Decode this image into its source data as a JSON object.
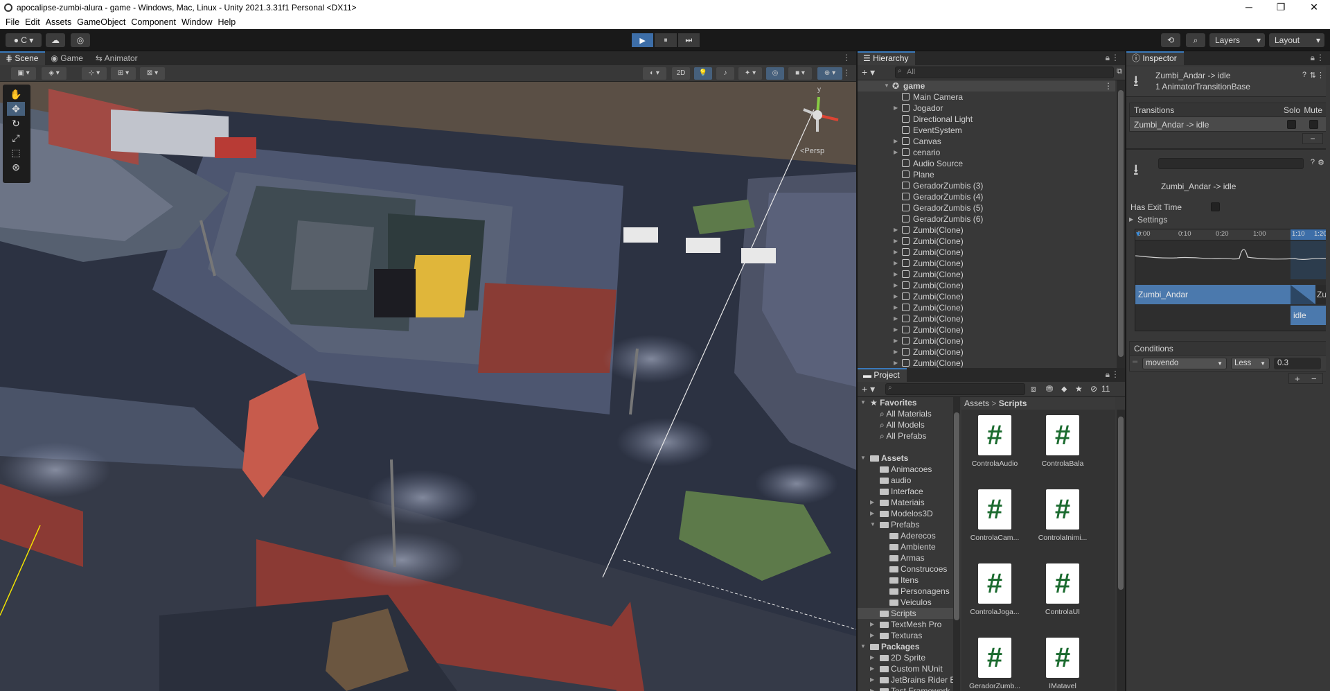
{
  "window": {
    "title": "apocalipse-zumbi-alura - game - Windows, Mac, Linux - Unity 2021.3.31f1 Personal <DX11>",
    "controls": [
      "─",
      "❐",
      "✕"
    ]
  },
  "menu": [
    "File",
    "Edit",
    "Assets",
    "GameObject",
    "Component",
    "Window",
    "Help"
  ],
  "toolbar": {
    "account_label": "C",
    "play": "▶",
    "pause": "⏸",
    "step": "⏭",
    "layers_label": "Layers",
    "layout_label": "Layout"
  },
  "scene_panel": {
    "tabs": [
      "Scene",
      "Game",
      "Animator"
    ],
    "mode_2d": "2D",
    "persp_label": "<Persp",
    "axis_y": "y"
  },
  "hierarchy": {
    "tab": "Hierarchy",
    "search_placeholder": "All",
    "root": "game",
    "items": [
      {
        "label": "Main Camera",
        "expandable": false
      },
      {
        "label": "Jogador",
        "expandable": true
      },
      {
        "label": "Directional Light",
        "expandable": false
      },
      {
        "label": "EventSystem",
        "expandable": false
      },
      {
        "label": "Canvas",
        "expandable": true
      },
      {
        "label": "cenario",
        "expandable": true
      },
      {
        "label": "Audio Source",
        "expandable": false
      },
      {
        "label": "Plane",
        "expandable": false
      },
      {
        "label": "GeradorZumbis (3)",
        "expandable": false
      },
      {
        "label": "GeradorZumbis (4)",
        "expandable": false
      },
      {
        "label": "GeradorZumbis (5)",
        "expandable": false
      },
      {
        "label": "GeradorZumbis (6)",
        "expandable": false
      },
      {
        "label": "Zumbi(Clone)",
        "expandable": true
      },
      {
        "label": "Zumbi(Clone)",
        "expandable": true
      },
      {
        "label": "Zumbi(Clone)",
        "expandable": true
      },
      {
        "label": "Zumbi(Clone)",
        "expandable": true
      },
      {
        "label": "Zumbi(Clone)",
        "expandable": true
      },
      {
        "label": "Zumbi(Clone)",
        "expandable": true
      },
      {
        "label": "Zumbi(Clone)",
        "expandable": true
      },
      {
        "label": "Zumbi(Clone)",
        "expandable": true
      },
      {
        "label": "Zumbi(Clone)",
        "expandable": true
      },
      {
        "label": "Zumbi(Clone)",
        "expandable": true
      },
      {
        "label": "Zumbi(Clone)",
        "expandable": true
      },
      {
        "label": "Zumbi(Clone)",
        "expandable": true
      },
      {
        "label": "Zumbi(Clone)",
        "expandable": true
      }
    ]
  },
  "project": {
    "tab": "Project",
    "hidden_count": "11",
    "breadcrumb": [
      "Assets",
      "Scripts"
    ],
    "tree": [
      {
        "label": "Favorites",
        "depth": 0,
        "kind": "star",
        "arrow": "▼",
        "bold": true
      },
      {
        "label": "All Materials",
        "depth": 1,
        "kind": "search",
        "arrow": "",
        "bold": false
      },
      {
        "label": "All Models",
        "depth": 1,
        "kind": "search",
        "arrow": "",
        "bold": false
      },
      {
        "label": "All Prefabs",
        "depth": 1,
        "kind": "search",
        "arrow": "",
        "bold": false
      },
      {
        "label": "",
        "depth": 0,
        "kind": "none",
        "arrow": "",
        "bold": false
      },
      {
        "label": "Assets",
        "depth": 0,
        "kind": "folder",
        "arrow": "▼",
        "bold": true
      },
      {
        "label": "Animacoes",
        "depth": 1,
        "kind": "folder",
        "arrow": "",
        "bold": false
      },
      {
        "label": "audio",
        "depth": 1,
        "kind": "folder",
        "arrow": "",
        "bold": false
      },
      {
        "label": "Interface",
        "depth": 1,
        "kind": "folder",
        "arrow": "",
        "bold": false
      },
      {
        "label": "Materiais",
        "depth": 1,
        "kind": "folder",
        "arrow": "▶",
        "bold": false
      },
      {
        "label": "Modelos3D",
        "depth": 1,
        "kind": "folder",
        "arrow": "▶",
        "bold": false
      },
      {
        "label": "Prefabs",
        "depth": 1,
        "kind": "folder",
        "arrow": "▼",
        "bold": false
      },
      {
        "label": "Aderecos",
        "depth": 2,
        "kind": "folder",
        "arrow": "",
        "bold": false
      },
      {
        "label": "Ambiente",
        "depth": 2,
        "kind": "folder",
        "arrow": "",
        "bold": false
      },
      {
        "label": "Armas",
        "depth": 2,
        "kind": "folder",
        "arrow": "",
        "bold": false
      },
      {
        "label": "Construcoes",
        "depth": 2,
        "kind": "folder",
        "arrow": "",
        "bold": false
      },
      {
        "label": "Itens",
        "depth": 2,
        "kind": "folder",
        "arrow": "",
        "bold": false
      },
      {
        "label": "Personagens",
        "depth": 2,
        "kind": "folder",
        "arrow": "",
        "bold": false
      },
      {
        "label": "Veiculos",
        "depth": 2,
        "kind": "folder",
        "arrow": "",
        "bold": false
      },
      {
        "label": "Scripts",
        "depth": 1,
        "kind": "folder",
        "arrow": "",
        "bold": false
      },
      {
        "label": "TextMesh Pro",
        "depth": 1,
        "kind": "folder",
        "arrow": "▶",
        "bold": false
      },
      {
        "label": "Texturas",
        "depth": 1,
        "kind": "folder",
        "arrow": "▶",
        "bold": false
      },
      {
        "label": "Packages",
        "depth": 0,
        "kind": "folder",
        "arrow": "▼",
        "bold": true
      },
      {
        "label": "2D Sprite",
        "depth": 1,
        "kind": "folder",
        "arrow": "▶",
        "bold": false
      },
      {
        "label": "Custom NUnit",
        "depth": 1,
        "kind": "folder",
        "arrow": "▶",
        "bold": false
      },
      {
        "label": "JetBrains Rider E",
        "depth": 1,
        "kind": "folder",
        "arrow": "▶",
        "bold": false
      },
      {
        "label": "Test Framework",
        "depth": 1,
        "kind": "folder",
        "arrow": "▶",
        "bold": false
      }
    ],
    "selected_folder": "Scripts",
    "assets": [
      {
        "label": "ControlaAudio",
        "glyph": "#"
      },
      {
        "label": "ControlaBala",
        "glyph": "#"
      },
      {
        "label": "ControlaCam...",
        "glyph": "#"
      },
      {
        "label": "ControlaInimi...",
        "glyph": "#"
      },
      {
        "label": "ControlaJoga...",
        "glyph": "#"
      },
      {
        "label": "ControlaUI",
        "glyph": "#"
      },
      {
        "label": "GeradorZumb...",
        "glyph": "#"
      },
      {
        "label": "IMatavel",
        "glyph": "#"
      }
    ]
  },
  "inspector": {
    "tab": "Inspector",
    "header_title": "Zumbi_Andar -> idle",
    "header_subtitle": "1 AnimatorTransitionBase",
    "transitions_label": "Transitions",
    "solo_label": "Solo",
    "mute_label": "Mute",
    "transition_item": "Zumbi_Andar -> idle",
    "minus": "−",
    "transition_name": "Zumbi_Andar -> idle",
    "has_exit_time_label": "Has Exit Time",
    "settings_label": "Settings",
    "timeline_ticks": [
      "0:00",
      "0:10",
      "0:20",
      "1:00",
      "1:10",
      "1:20"
    ],
    "clip_from": "Zumbi_Andar",
    "clip_from_cut": "Zu",
    "clip_to": "idle",
    "conditions_label": "Conditions",
    "condition": {
      "parameter": "movendo",
      "operator": "Less",
      "value": "0.3"
    },
    "plus": "+",
    "minus2": "−"
  },
  "colors": {
    "accent": "#3a79bb",
    "selection": "#2c5d87",
    "panel": "#383838",
    "script_hash": "#1b6b2f"
  }
}
